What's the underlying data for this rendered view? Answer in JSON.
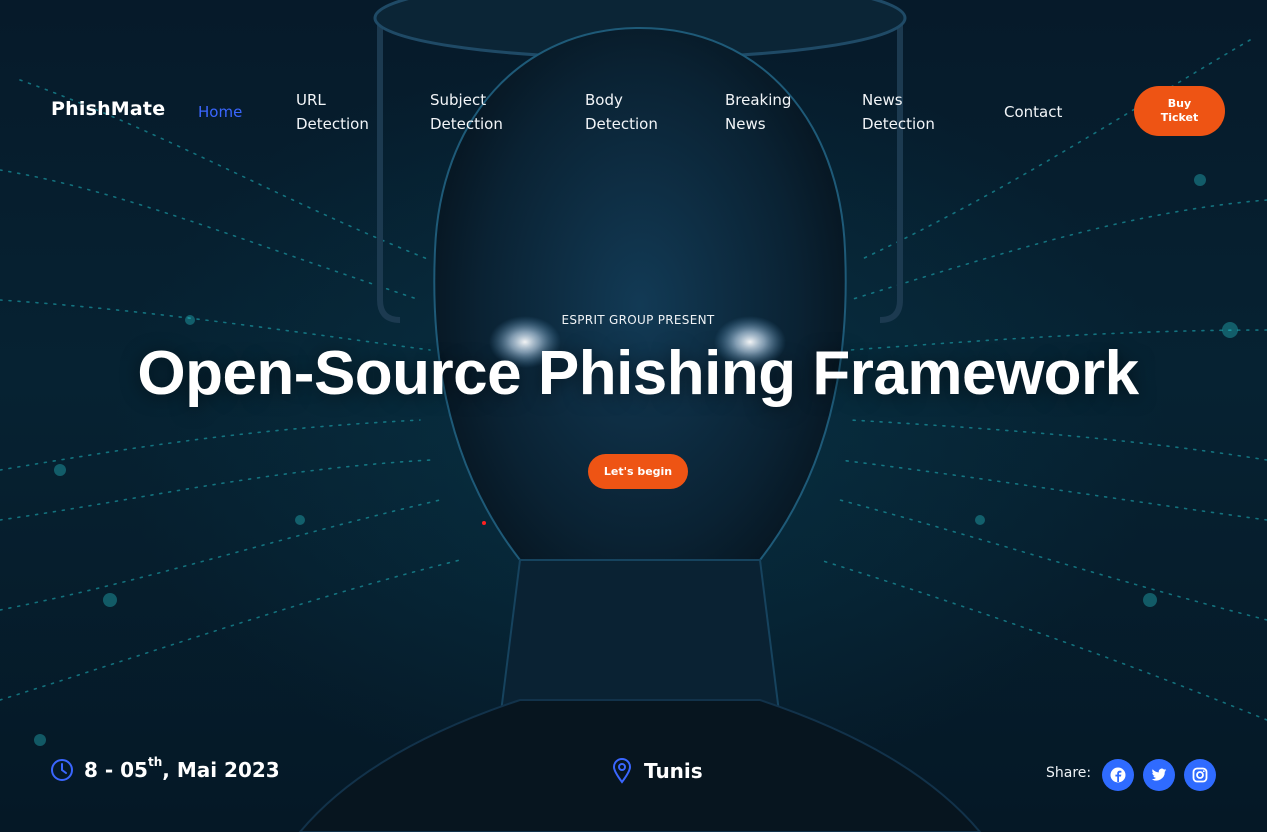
{
  "brand": {
    "name": "PhishMate"
  },
  "nav": {
    "items": [
      {
        "label": "Home",
        "active": true
      },
      {
        "label": "URL\nDetection",
        "active": false
      },
      {
        "label": "Subject\nDetection",
        "active": false
      },
      {
        "label": "Body\nDetection",
        "active": false
      },
      {
        "label": "Breaking\nNews",
        "active": false
      },
      {
        "label": "News\nDetection",
        "active": false
      },
      {
        "label": "Contact",
        "active": false
      }
    ],
    "ticket_button": "Buy\nTicket"
  },
  "hero": {
    "eyebrow": "ESPRIT GROUP PRESENT",
    "headline": "Open-Source Phishing Framework",
    "cta": "Let's begin"
  },
  "event": {
    "date_prefix": "8 - 05",
    "date_suffix_sup": "th",
    "date_rest": ", Mai 2023",
    "location": "Tunis"
  },
  "share": {
    "label": "Share:",
    "icons": [
      "facebook-icon",
      "twitter-icon",
      "instagram-icon"
    ]
  },
  "colors": {
    "accent_orange": "#ee5414",
    "accent_blue": "#2f6bff",
    "active_nav": "#3a66ff",
    "background": "#04101c"
  }
}
